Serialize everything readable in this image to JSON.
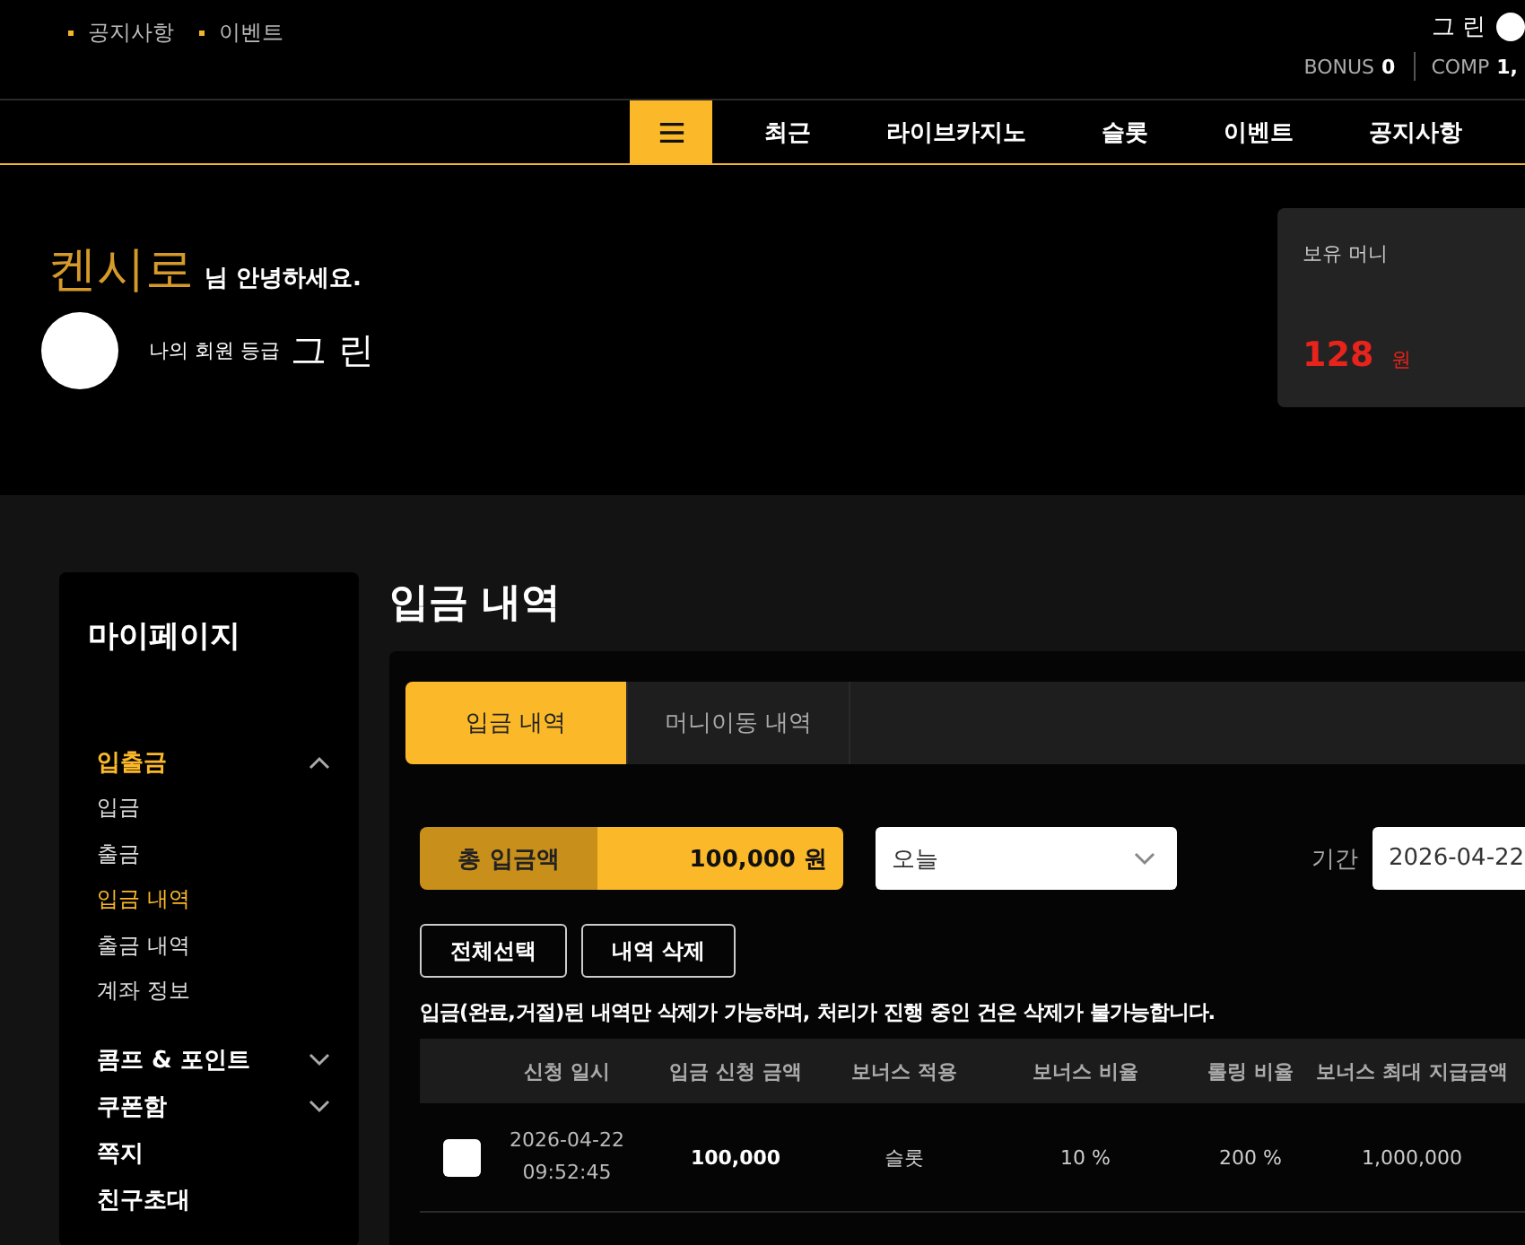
{
  "top_links": [
    "공지사항",
    "이벤트"
  ],
  "user": {
    "grade": "그 린",
    "bonus_label": "BONUS",
    "bonus": "0",
    "comp_label": "COMP",
    "comp": "1,"
  },
  "nav": {
    "items": [
      "최근",
      "라이브카지노",
      "슬롯",
      "이벤트",
      "공지사항"
    ]
  },
  "hero": {
    "name": "켄시로",
    "greeting": "님 안녕하세요.",
    "grade_label": "나의 회원 등급",
    "grade": "그 린"
  },
  "money_card": {
    "label": "보유 머니",
    "amount": "128",
    "unit": "원"
  },
  "sidebar": {
    "title": "마이페이지",
    "sections": [
      {
        "kind": "group",
        "label": "입출금",
        "selected": true,
        "expanded": true,
        "children": [
          {
            "label": "입금",
            "selected": false
          },
          {
            "label": "출금",
            "selected": false
          },
          {
            "label": "입금 내역",
            "selected": true
          },
          {
            "label": "출금 내역",
            "selected": false
          },
          {
            "label": "계좌 정보",
            "selected": false
          }
        ]
      },
      {
        "kind": "group",
        "label": "콤프 & 포인트",
        "selected": false,
        "expanded": false
      },
      {
        "kind": "group",
        "label": "쿠폰함",
        "selected": false,
        "expanded": false
      },
      {
        "kind": "link",
        "label": "쪽지",
        "selected": false
      },
      {
        "kind": "link",
        "label": "친구초대",
        "selected": false
      }
    ]
  },
  "page_title": "입금 내역",
  "tabs": [
    {
      "label": "입금 내역",
      "selected": true
    },
    {
      "label": "머니이동 내역",
      "selected": false
    }
  ],
  "summary": {
    "label": "총 입금액",
    "value": "100,000 원"
  },
  "period_select": {
    "value": "오늘"
  },
  "period": {
    "label": "기간",
    "start": "2026-04-22"
  },
  "buttons": [
    "전체선택",
    "내역 삭제"
  ],
  "notice": "입금(완료,거절)된 내역만 삭제가 가능하며, 처리가 진행 중인 건은 삭제가 불가능합니다.",
  "table": {
    "columns": [
      "",
      "신청 일시",
      "입금 신청 금액",
      "보너스 적용",
      "보너스 비율",
      "롤링 비율",
      "보너스 최대 지급금액"
    ],
    "rows": [
      {
        "checked": false,
        "date": "2026-04-22",
        "time": "09:52:45",
        "amount": "100,000",
        "bonus_type": "슬롯",
        "bonus_rate": "10 %",
        "rolling_rate": "200 %",
        "bonus_max": "1,000,000"
      }
    ]
  }
}
